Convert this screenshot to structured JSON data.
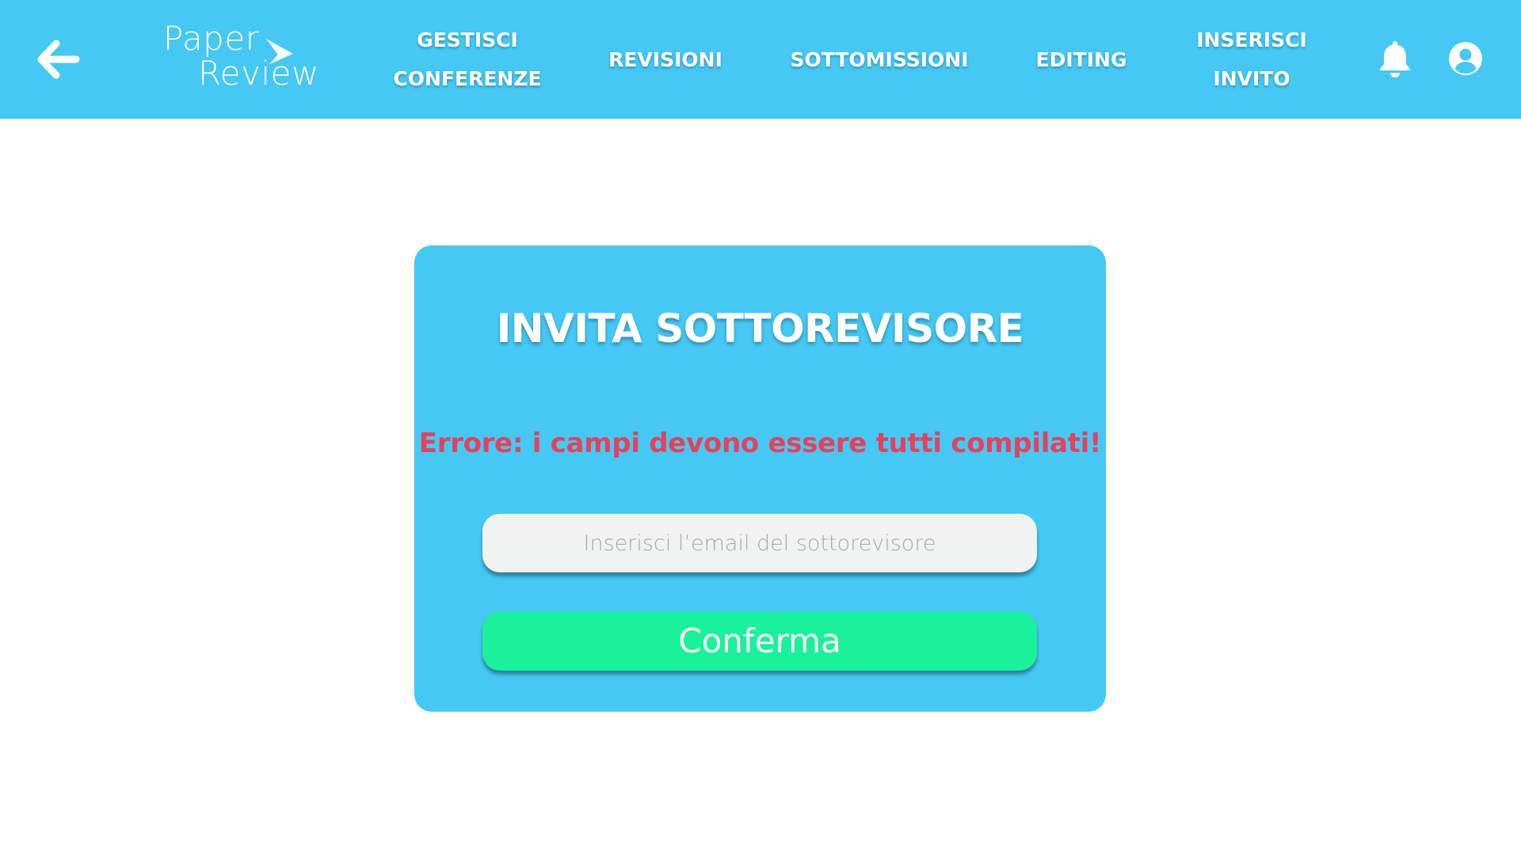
{
  "header": {
    "logo": {
      "line1": "Paper",
      "line2": "Review"
    },
    "back_icon": "arrow-left-icon",
    "nav": [
      {
        "id": "gestisci-conferenze",
        "label": "GESTISCI\nCONFERENZE"
      },
      {
        "id": "revisioni",
        "label": "REVISIONI"
      },
      {
        "id": "sottomissioni",
        "label": "SOTTOMISSIONI"
      },
      {
        "id": "editing",
        "label": "EDITING"
      },
      {
        "id": "inserisci-invito",
        "label": "INSERISCI\nINVITO"
      }
    ],
    "notification_icon": "bell-icon",
    "profile_icon": "user-circle-icon"
  },
  "card": {
    "title": "INVITA SOTTOREVISORE",
    "error": "Errore: i campi devono essere tutti compilati!",
    "email_input": {
      "value": "",
      "placeholder": "Inserisci l’email del sottorevisore"
    },
    "confirm_label": "Conferma"
  },
  "colors": {
    "primary": "#45C8F4",
    "error": "#E8405A",
    "confirm": "#19F29A",
    "input_bg": "#F1F2F2",
    "white": "#FFFFFF"
  }
}
